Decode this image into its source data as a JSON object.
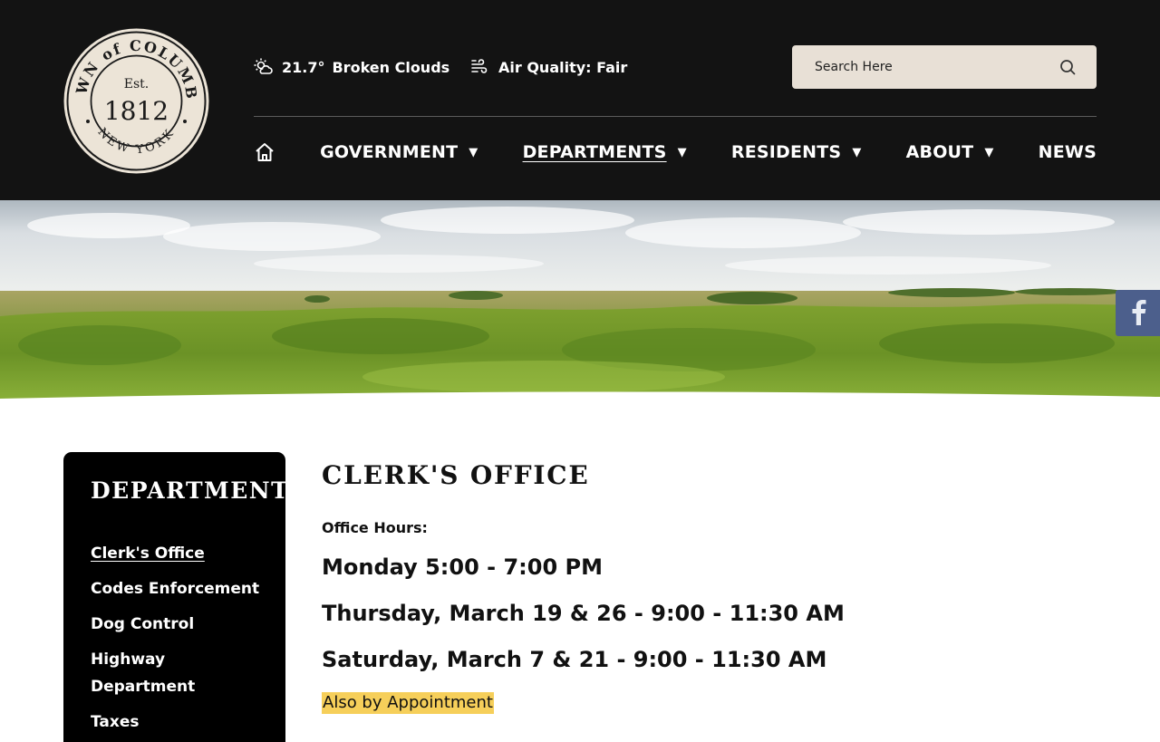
{
  "seal": {
    "top_text": "TOWN of COLUMBIA",
    "est": "Est.",
    "year": "1812",
    "bottom_text": "NEW YORK"
  },
  "weather": {
    "temperature": "21.7°",
    "condition": "Broken Clouds",
    "icon": "partly-cloudy-icon"
  },
  "air_quality": {
    "text": "Air Quality: Fair",
    "icon": "wind-icon"
  },
  "search": {
    "placeholder": "Search Here",
    "icon": "search-icon"
  },
  "nav": {
    "home_icon": "home-icon",
    "items": [
      {
        "label": "GOVERNMENT",
        "has_dropdown": true
      },
      {
        "label": "DEPARTMENTS",
        "has_dropdown": true,
        "active": true
      },
      {
        "label": "RESIDENTS",
        "has_dropdown": true
      },
      {
        "label": "ABOUT",
        "has_dropdown": true
      },
      {
        "label": "NEWS",
        "has_dropdown": false
      }
    ],
    "caret": "▼"
  },
  "social": {
    "facebook_icon": "facebook-icon"
  },
  "sidebar": {
    "title": "DEPARTMENTS",
    "items": [
      {
        "label": "Clerk's Office",
        "active": true
      },
      {
        "label": "Codes Enforcement"
      },
      {
        "label": "Dog Control"
      },
      {
        "label": "Highway Department"
      },
      {
        "label": "Taxes"
      }
    ]
  },
  "main": {
    "title": "CLERK'S OFFICE",
    "hours_label": "Office Hours:",
    "hours": [
      "Monday 5:00 - 7:00 PM",
      "Thursday, March 19 & 26 - 9:00 - 11:30 AM",
      "Saturday, March 7 & 21 - 9:00 - 11:30 AM"
    ],
    "appointment_note": "Also by Appointment"
  },
  "colors": {
    "header_bg": "#131313",
    "search_bg": "#e8e0d6",
    "highlight": "#f6cf5a",
    "facebook": "#4c5f8c"
  }
}
